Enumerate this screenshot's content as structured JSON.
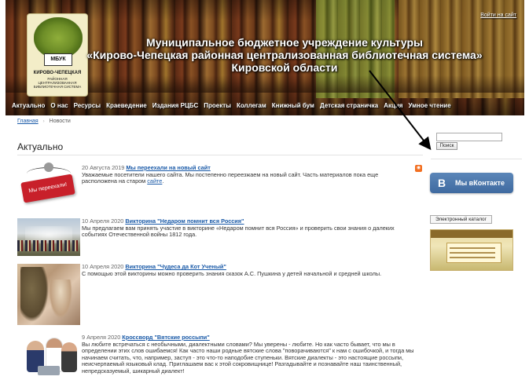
{
  "header": {
    "title_line1": "Муниципальное бюджетное учреждение культуры",
    "title_line2": "«Кирово-Чепецкая районная централизованная библиотечная система»",
    "title_line3": "Кировской области",
    "login_link": "Войти на сайт",
    "logo": {
      "badge": "МБУК",
      "name_line1": "КИРОВО-ЧЕПЕЦКАЯ",
      "name_line2": "РАЙОННАЯ ЦЕНТРАЛИЗОВАННАЯ БИБЛИОТЕЧНАЯ СИСТЕМА"
    }
  },
  "nav": {
    "items": [
      "Актуально",
      "О нас",
      "Ресурсы",
      "Краеведение",
      "Издания РЦБС",
      "Проекты",
      "Коллегам",
      "Книжный бум",
      "Детская страничка",
      "Акция",
      "Умное чтение"
    ]
  },
  "breadcrumb": {
    "home": "Главная",
    "separator": "›",
    "current": "Новости"
  },
  "main": {
    "title": "Актуально",
    "rss_icon": "rss-icon",
    "news": [
      {
        "date": "20 Августа 2019",
        "title": "Мы переехали на новый сайт",
        "text": "Уважаемые посетители нашего сайта. Мы постепенно переезжаем на новый сайт. Часть материалов пока еще расположена на старом ",
        "link_text": "сайте",
        "text_after": ".",
        "thumb_caption": "Мы переехали!"
      },
      {
        "date": "10 Апреля 2020",
        "title": "Викторина \"Недаром помнит вся Россия\"",
        "text": "Мы предлагаем вам принять участие в викторине «Недаром помнит вся Россия» и проверить свои знания о далеких событиях Отечественной войны 1812 года."
      },
      {
        "date": "10 Апреля 2020",
        "title": "Викторина \"Чудеса да Кот Ученый\"",
        "text": "С помощью этой викторины можно проверить знания сказок А.С. Пушкина у детей начальной и средней школы."
      },
      {
        "date": "9 Апреля 2020",
        "title": "Кроссворд \"Вятские россыпи\"",
        "text": "Вы любите встречаться с необычными, диалектными словами? Мы уверены - любите. Но как часто бывает, что мы в определении этих слов ошибаемся! Как часто наши родные вятские слова \"поворачиваются\" к нам с ошибочкой, и тогда мы начинаем считать, что, например, заступ - это что-то наподобие ступеньки. Вятские диалекты - это настоящие россыпи, неисчерпаемый языковый клад. Приглашаем вас к этой сокровищнице! Разгадывайте и познавайте наш таинственный, непредсказуемый, шикарный диалект!"
      }
    ]
  },
  "sidebar": {
    "search": {
      "value": "",
      "button_label": "Поиск"
    },
    "vk": {
      "logo": "В",
      "label": "Мы вКонтакте"
    },
    "catalog_label": "Электронный каталог"
  },
  "colors": {
    "link": "#1a5aa8",
    "vk_blue": "#4a76a8",
    "rss_orange": "#f26f21",
    "sign_red": "#c8202a"
  }
}
